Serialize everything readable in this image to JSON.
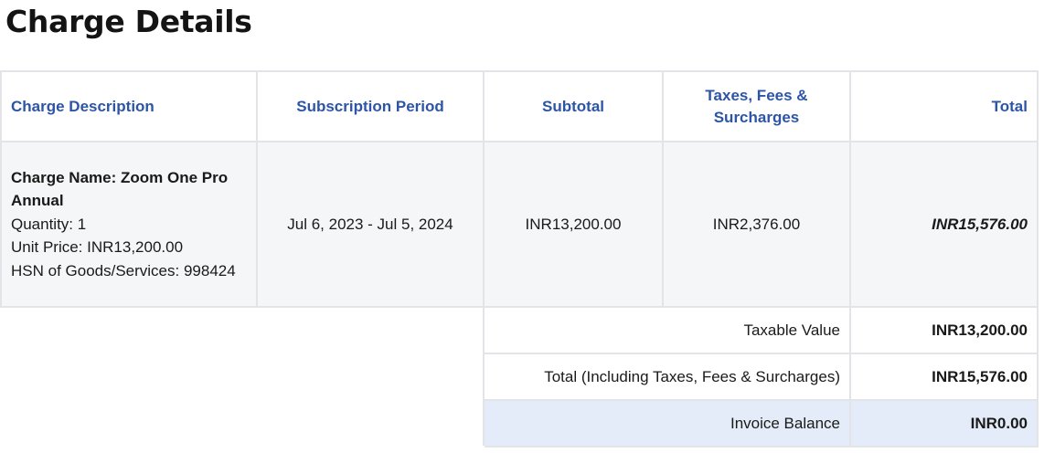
{
  "title": "Charge Details",
  "table": {
    "headers": {
      "description": "Charge Description",
      "period": "Subscription Period",
      "subtotal": "Subtotal",
      "taxes": "Taxes, Fees & Surcharges",
      "total": "Total"
    },
    "row": {
      "charge_name": "Charge Name: Zoom One Pro Annual",
      "quantity": "Quantity: 1",
      "unit_price": "Unit Price: INR13,200.00",
      "hsn": "HSN of Goods/Services: 998424",
      "period": "Jul 6, 2023 - Jul 5, 2024",
      "subtotal": "INR13,200.00",
      "taxes": "INR2,376.00",
      "total": "INR15,576.00"
    }
  },
  "summary": {
    "taxable_label": "Taxable Value",
    "taxable_value": "INR13,200.00",
    "total_label": "Total (Including Taxes, Fees & Surcharges)",
    "total_value": "INR15,576.00",
    "balance_label": "Invoice Balance",
    "balance_value": "INR0.00"
  }
}
